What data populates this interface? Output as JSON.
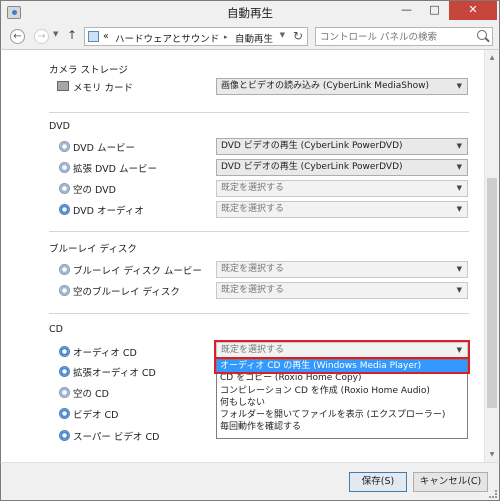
{
  "window": {
    "title": "自動再生",
    "minimize_glyph": "—",
    "maximize_glyph": "□",
    "close_glyph": "✕"
  },
  "nav": {
    "back_glyph": "←",
    "forward_glyph": "→",
    "dropdown_glyph": "▼",
    "up_glyph": "↑",
    "overflow": "«",
    "breadcrumb": [
      "ハードウェアとサウンド",
      "自動再生"
    ],
    "separator": "▸",
    "refresh_glyph": "↻",
    "search_placeholder": "コントロール パネルの検索"
  },
  "sections": [
    {
      "title": "カメラ ストレージ",
      "rows": [
        {
          "label": "メモリ カード",
          "value": "画像とビデオの読み込み (CyberLink MediaShow)",
          "icon": "memory-card-icon"
        }
      ]
    },
    {
      "title": "DVD",
      "rows": [
        {
          "label": "DVD ムービー",
          "value": "DVD ビデオの再生 (CyberLink PowerDVD)",
          "icon": "dvd-disc-icon"
        },
        {
          "label": "拡張 DVD ムービー",
          "value": "DVD ビデオの再生 (CyberLink PowerDVD)",
          "icon": "dvd-disc-icon"
        },
        {
          "label": "空の DVD",
          "value": "既定を選択する",
          "icon": "disc-icon"
        },
        {
          "label": "DVD オーディオ",
          "value": "既定を選択する",
          "icon": "media-disc-icon"
        }
      ]
    },
    {
      "title": "ブルーレイ ディスク",
      "rows": [
        {
          "label": "ブルーレイ ディスク ムービー",
          "value": "既定を選択する",
          "icon": "dvd-disc-icon"
        },
        {
          "label": "空のブルーレイ ディスク",
          "value": "既定を選択する",
          "icon": "disc-icon"
        }
      ]
    },
    {
      "title": "CD",
      "rows": [
        {
          "label": "オーディオ CD",
          "value": "既定を選択する",
          "icon": "media-disc-icon"
        },
        {
          "label": "拡張オーディオ CD",
          "icon": "media-disc-icon"
        },
        {
          "label": "空の CD",
          "icon": "disc-icon"
        },
        {
          "label": "ビデオ CD",
          "icon": "media-disc-icon"
        },
        {
          "label": "スーパー ビデオ CD",
          "icon": "media-disc-icon"
        }
      ]
    }
  ],
  "dropdown": {
    "options": [
      "オーディオ CD の再生 (Windows Media Player)",
      "CD をコピー (Roxio Home Copy)",
      "コンピレーション CD を作成 (Roxio Home Audio)",
      "何もしない",
      "フォルダーを開いてファイルを表示 (エクスプローラー)",
      "毎回動作を確認する"
    ],
    "highlighted_index": 0
  },
  "dropdown_arrow": "▼",
  "footer": {
    "save_label": "保存(S)",
    "cancel_label": "キャンセル(C)"
  },
  "colors": {
    "highlight_border": "#d81d2c",
    "selection": "#3399ff",
    "close_button": "#c7463c"
  }
}
